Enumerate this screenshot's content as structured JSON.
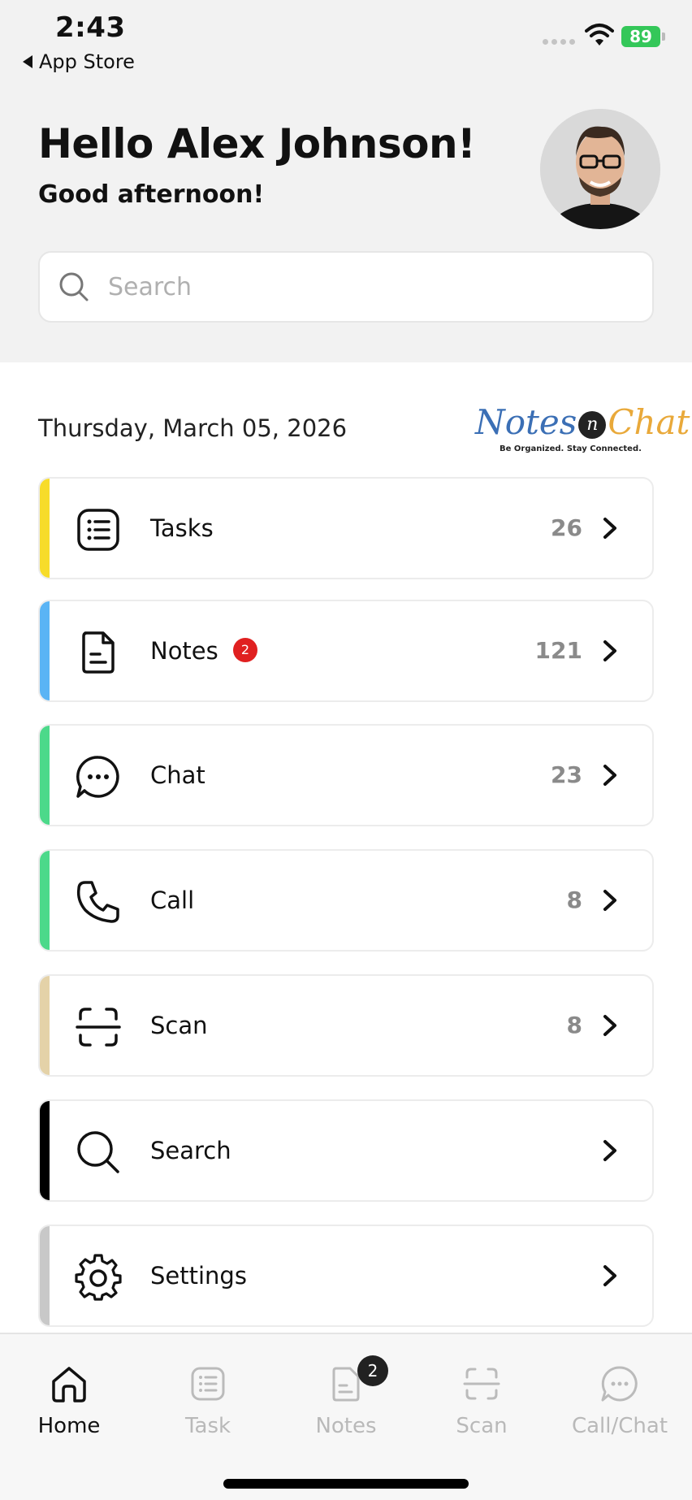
{
  "status_bar": {
    "time": "2:43",
    "back_label": "App Store",
    "battery": "89"
  },
  "header": {
    "greeting": "Hello Alex Johnson!",
    "subgreeting": "Good afternoon!"
  },
  "search": {
    "placeholder": "Search"
  },
  "date": "Thursday, March 05, 2026",
  "logo": {
    "part1": "Notes",
    "part_n": "n",
    "part2": "Chat",
    "tagline": "Be Organized. Stay Connected."
  },
  "menu": [
    {
      "label": "Tasks",
      "count": "26",
      "color": "#f7dc2a",
      "icon": "list-icon"
    },
    {
      "label": "Notes",
      "count": "121",
      "badge": "2",
      "color": "#5ab4f5",
      "icon": "note-icon"
    },
    {
      "label": "Chat",
      "count": "23",
      "color": "#4cd98a",
      "icon": "chat-bubble-icon"
    },
    {
      "label": "Call",
      "count": "8",
      "color": "#4cd98a",
      "icon": "phone-icon"
    },
    {
      "label": "Scan",
      "count": "8",
      "color": "#e4d2a8",
      "icon": "scan-icon"
    },
    {
      "label": "Search",
      "count": "",
      "color": "#000000",
      "icon": "search-icon"
    },
    {
      "label": "Settings",
      "count": "",
      "color": "#c8c8c8",
      "icon": "gear-icon"
    }
  ],
  "tabbar": [
    {
      "label": "Home",
      "active": true,
      "icon": "home-icon"
    },
    {
      "label": "Task",
      "active": false,
      "icon": "list-icon"
    },
    {
      "label": "Notes",
      "active": false,
      "badge": "2",
      "icon": "note-icon"
    },
    {
      "label": "Scan",
      "active": false,
      "icon": "scan-icon"
    },
    {
      "label": "Call/Chat",
      "active": false,
      "icon": "chat-bubble-icon"
    }
  ]
}
